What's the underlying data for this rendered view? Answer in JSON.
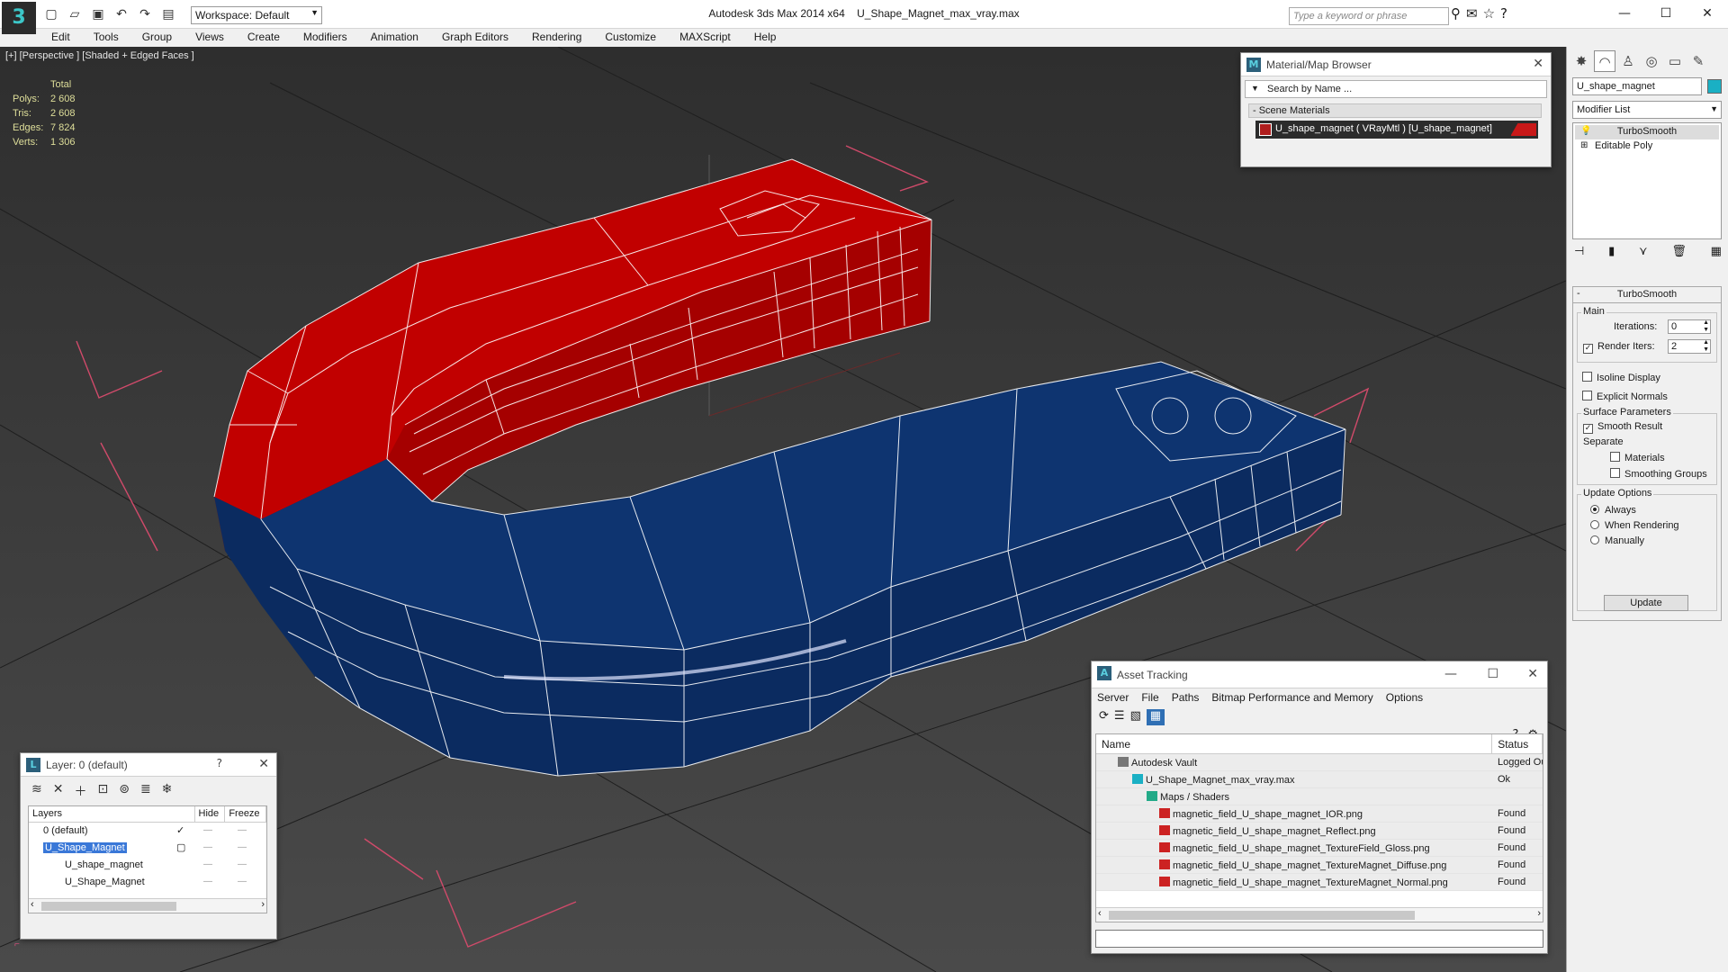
{
  "app": {
    "title_left": "Autodesk 3ds Max  2014 x64",
    "title_file": "U_Shape_Magnet_max_vray.max",
    "workspace": "Workspace: Default",
    "search_placeholder": "Type a keyword or phrase"
  },
  "menu": [
    "Edit",
    "Tools",
    "Group",
    "Views",
    "Create",
    "Modifiers",
    "Animation",
    "Graph Editors",
    "Rendering",
    "Customize",
    "MAXScript",
    "Help"
  ],
  "viewport": {
    "label": "[+] [Perspective ] [Shaded + Edged Faces ]",
    "stats_header": "Total",
    "stats": [
      {
        "key": "Polys:",
        "value": "2 608"
      },
      {
        "key": "Tris:",
        "value": "2 608"
      },
      {
        "key": "Edges:",
        "value": "7 824"
      },
      {
        "key": "Verts:",
        "value": "1 306"
      }
    ],
    "colors": {
      "background": "#464646",
      "red_half": "#a80000",
      "blue_half": "#0c2a5c",
      "wire": "#ffffff"
    }
  },
  "material_browser": {
    "title": "Material/Map Browser",
    "search_placeholder": "Search by Name ...",
    "section": "- Scene Materials",
    "item": "U_shape_magnet  ( VRayMtl )  [U_shape_magnet]"
  },
  "command_panel": {
    "object_name": "U_shape_magnet",
    "object_color": "#1ab0c4",
    "modifier_list": "Modifier List",
    "stack": [
      "TurboSmooth",
      "Editable Poly"
    ],
    "rollout_title": "TurboSmooth",
    "main_group": "Main",
    "iterations_label": "Iterations:",
    "iterations_value": "0",
    "render_iters_label": "Render Iters:",
    "render_iters_value": "2",
    "isoline_display": "Isoline Display",
    "explicit_normals": "Explicit Normals",
    "surface_group": "Surface Parameters",
    "smooth_result": "Smooth Result",
    "separate": "Separate",
    "materials": "Materials",
    "smoothing_groups": "Smoothing Groups",
    "update_group": "Update Options",
    "always": "Always",
    "when_rendering": "When Rendering",
    "manually": "Manually",
    "update_button": "Update"
  },
  "layer_panel": {
    "title": "Layer: 0 (default)",
    "help": "?",
    "col_layers": "Layers",
    "col_hide": "Hide",
    "col_freeze": "Freeze",
    "rows": [
      {
        "name": "0 (default)"
      },
      {
        "name": "U_Shape_Magnet"
      },
      {
        "name": "U_shape_magnet"
      },
      {
        "name": "U_Shape_Magnet"
      }
    ]
  },
  "asset_tracking": {
    "title": "Asset Tracking",
    "menu": [
      "Server",
      "File",
      "Paths",
      "Bitmap Performance and Memory",
      "Options"
    ],
    "col_name": "Name",
    "col_status": "Status",
    "rows": [
      {
        "name": "Autodesk Vault",
        "status": "Logged Out",
        "icon": "vault-icon"
      },
      {
        "name": "U_Shape_Magnet_max_vray.max",
        "status": "Ok",
        "icon": "max-file-icon"
      },
      {
        "name": "Maps / Shaders",
        "status": "",
        "icon": "folder-icon"
      },
      {
        "name": "magnetic_field_U_shape_magnet_IOR.png",
        "status": "Found",
        "icon": "png-icon"
      },
      {
        "name": "magnetic_field_U_shape_magnet_Reflect.png",
        "status": "Found",
        "icon": "png-icon"
      },
      {
        "name": "magnetic_field_U_shape_magnet_TextureField_Gloss.png",
        "status": "Found",
        "icon": "png-icon"
      },
      {
        "name": "magnetic_field_U_shape_magnet_TextureMagnet_Diffuse.png",
        "status": "Found",
        "icon": "png-icon"
      },
      {
        "name": "magnetic_field_U_shape_magnet_TextureMagnet_Normal.png",
        "status": "Found",
        "icon": "png-icon"
      }
    ]
  }
}
